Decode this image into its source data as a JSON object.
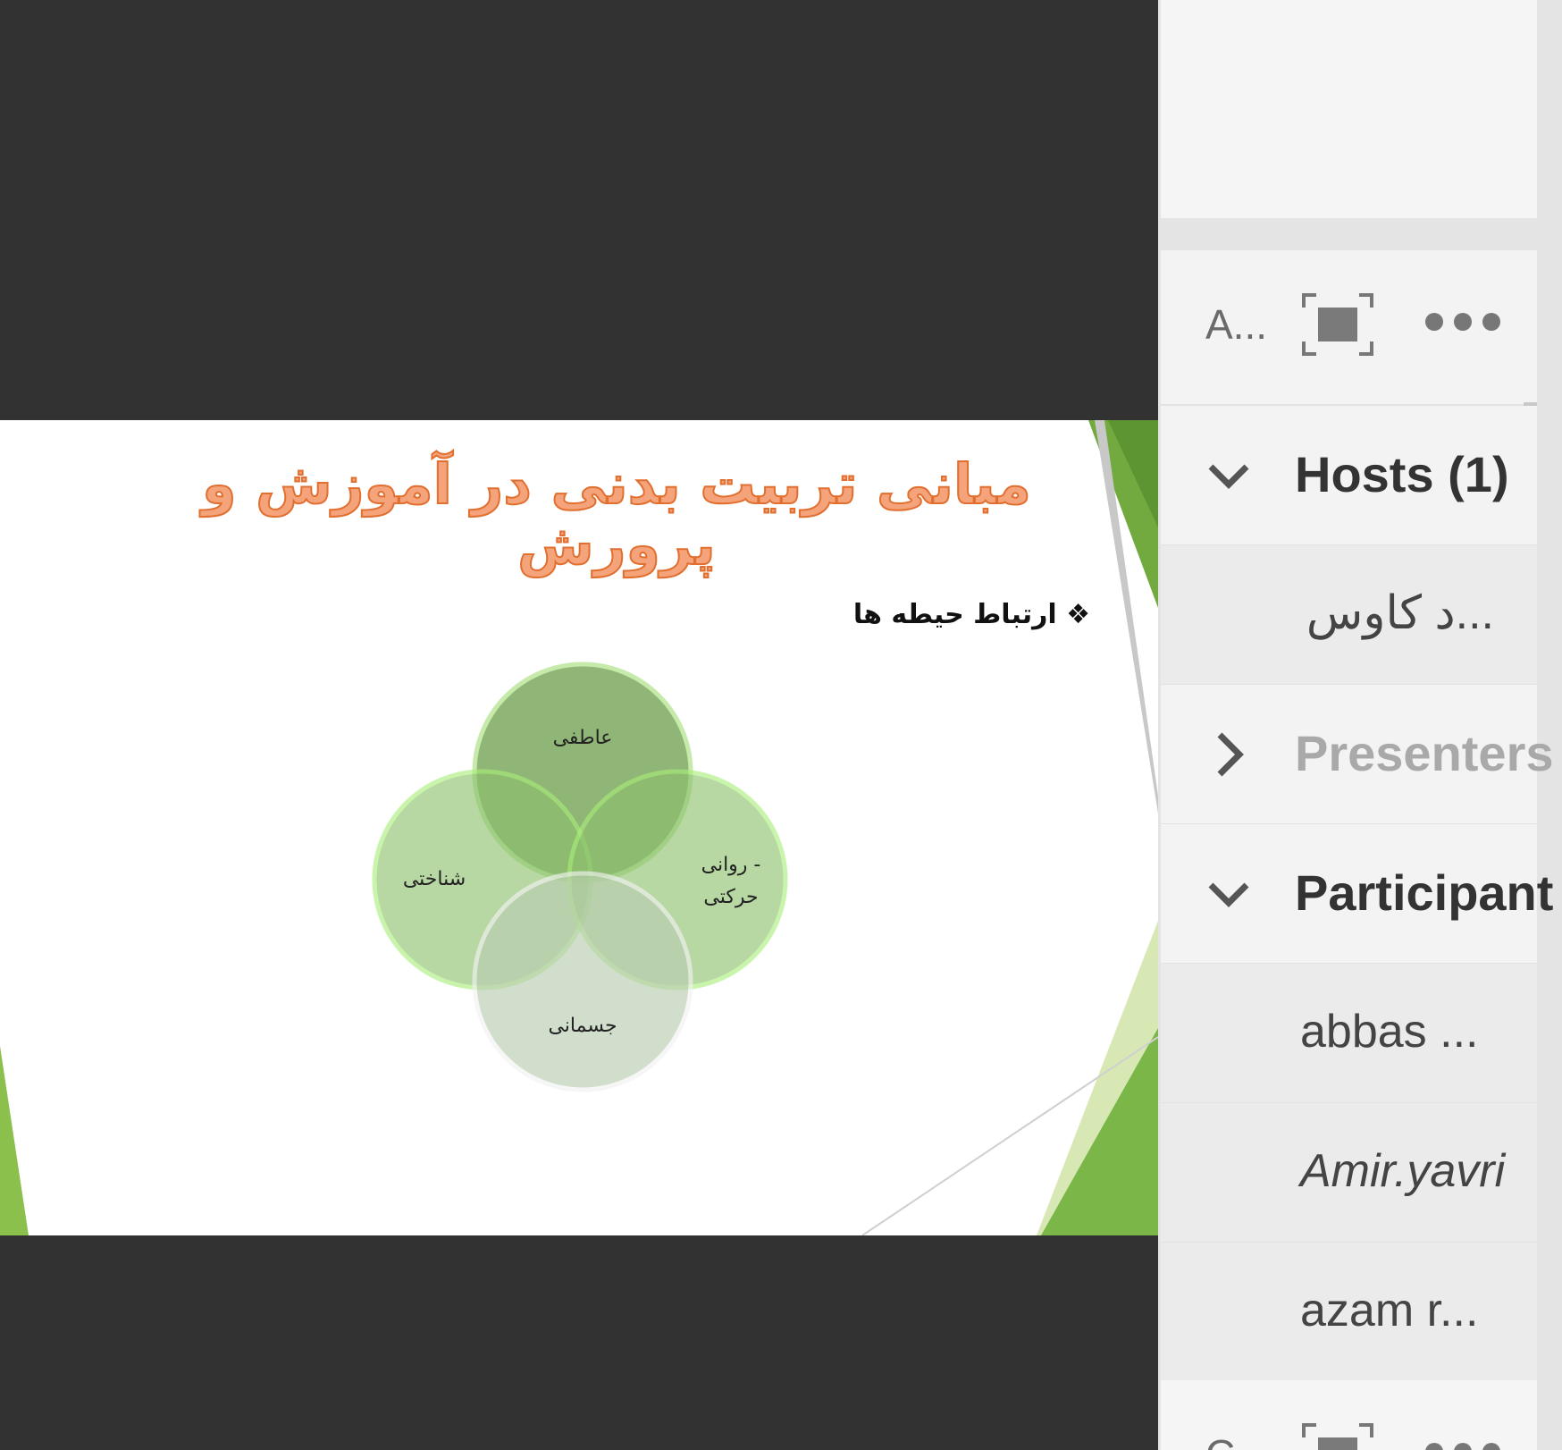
{
  "slide": {
    "title": "مبانی تربیت بدنی در آموزش و پرورش",
    "bullet_symbol": "❖",
    "bullet_text": "ارتباط حیطه ها",
    "venn_labels": {
      "top": "عاطفی",
      "left": "شناختی",
      "right_line1": "روانی -",
      "right_line2": "حرکتی",
      "bottom": "جسمانی"
    },
    "colors": {
      "accent_green": "#7ab648",
      "title_orange": "#e16f2f"
    }
  },
  "attendee_pod": {
    "title": "A...",
    "icons": {
      "fullscreen": "fullscreen-icon",
      "more": "more-options-icon"
    },
    "sections": [
      {
        "label": "Hosts (1)",
        "expanded": true,
        "icon": "chevron-down-icon"
      },
      {
        "label": "Presenters",
        "expanded": false,
        "icon": "chevron-right-icon"
      },
      {
        "label": "Participant",
        "expanded": true,
        "icon": "chevron-down-icon"
      }
    ],
    "hosts": [
      "...د کاوس"
    ],
    "participants": [
      "abbas ...",
      "Amir.yavri",
      "azam r..."
    ]
  },
  "bottom_pod": {
    "title": "C..."
  }
}
